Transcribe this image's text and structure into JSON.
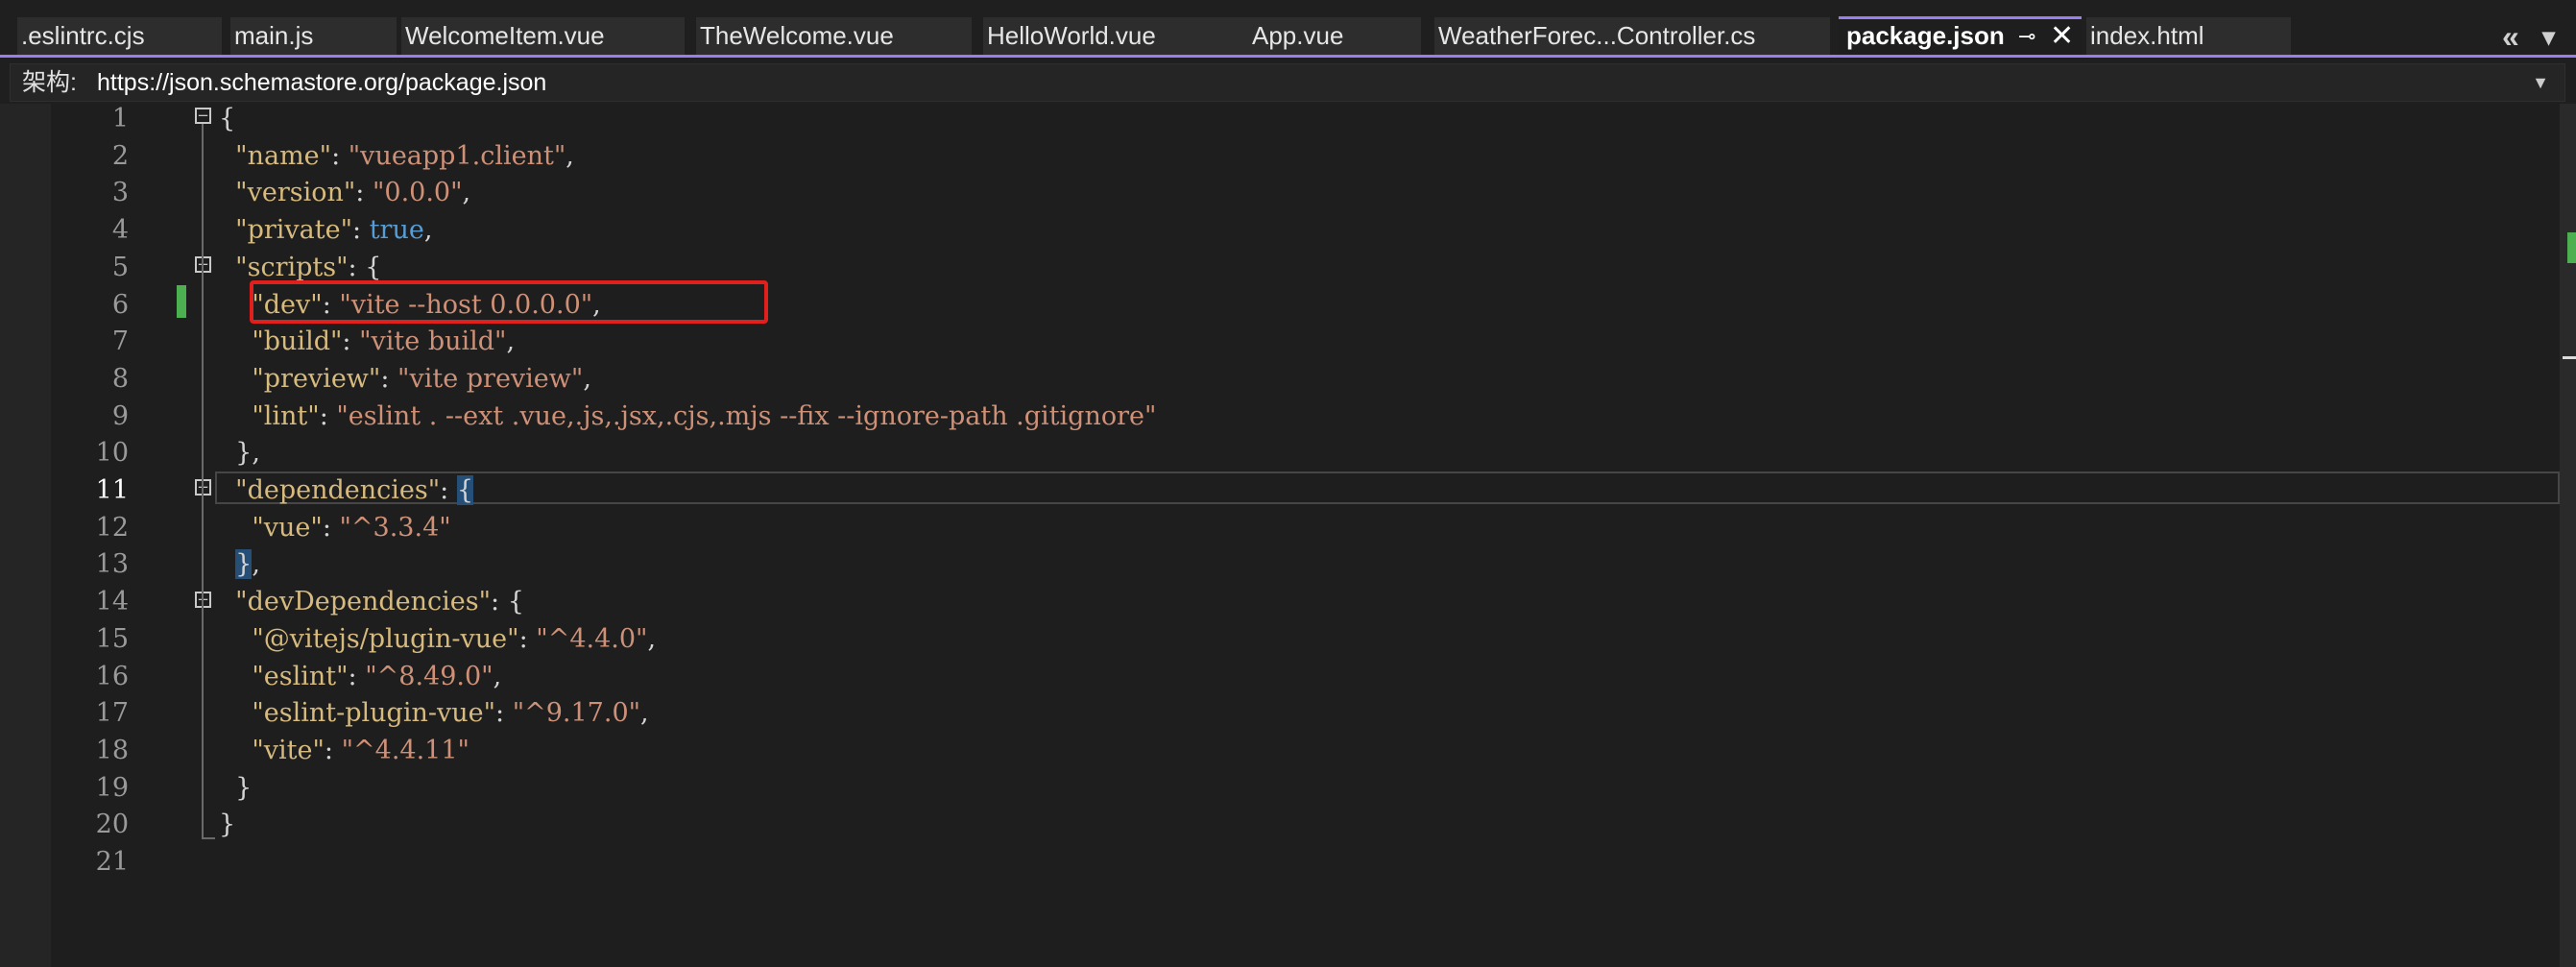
{
  "tabs": [
    {
      "label": ".eslintrc.cjs",
      "active": false
    },
    {
      "label": "main.js",
      "active": false
    },
    {
      "label": "WelcomeItem.vue",
      "active": false
    },
    {
      "label": "TheWelcome.vue",
      "active": false
    },
    {
      "label": "HelloWorld.vue",
      "active": false
    },
    {
      "label": "App.vue",
      "active": false
    },
    {
      "label": "WeatherForec...Controller.cs",
      "active": false
    },
    {
      "label": "package.json",
      "active": true
    },
    {
      "label": "index.html",
      "active": false
    }
  ],
  "tab_controls": {
    "pin_icon": "pin-icon",
    "close_icon": "close-icon",
    "overflow_left": "«",
    "overflow_menu": "▾"
  },
  "schema": {
    "label": "架构:",
    "value": "https://json.schemastore.org/package.json"
  },
  "editor": {
    "current_line": 11,
    "line_numbers": [
      "1",
      "2",
      "3",
      "4",
      "5",
      "6",
      "7",
      "8",
      "9",
      "10",
      "11",
      "12",
      "13",
      "14",
      "15",
      "16",
      "17",
      "18",
      "19",
      "20",
      "21"
    ],
    "lines": [
      [
        {
          "t": "p",
          "v": "{"
        }
      ],
      [
        {
          "t": "p",
          "v": "  "
        },
        {
          "t": "k",
          "v": "\"name\""
        },
        {
          "t": "p",
          "v": ": "
        },
        {
          "t": "s",
          "v": "\"vueapp1.client\""
        },
        {
          "t": "p",
          "v": ","
        }
      ],
      [
        {
          "t": "p",
          "v": "  "
        },
        {
          "t": "k",
          "v": "\"version\""
        },
        {
          "t": "p",
          "v": ": "
        },
        {
          "t": "s",
          "v": "\"0.0.0\""
        },
        {
          "t": "p",
          "v": ","
        }
      ],
      [
        {
          "t": "p",
          "v": "  "
        },
        {
          "t": "k",
          "v": "\"private\""
        },
        {
          "t": "p",
          "v": ": "
        },
        {
          "t": "b",
          "v": "true"
        },
        {
          "t": "p",
          "v": ","
        }
      ],
      [
        {
          "t": "p",
          "v": "  "
        },
        {
          "t": "k",
          "v": "\"scripts\""
        },
        {
          "t": "p",
          "v": ": {"
        }
      ],
      [
        {
          "t": "p",
          "v": "    "
        },
        {
          "t": "k",
          "v": "\"dev\""
        },
        {
          "t": "p",
          "v": ": "
        },
        {
          "t": "s",
          "v": "\"vite --host 0.0.0.0\""
        },
        {
          "t": "p",
          "v": ","
        }
      ],
      [
        {
          "t": "p",
          "v": "    "
        },
        {
          "t": "k",
          "v": "\"build\""
        },
        {
          "t": "p",
          "v": ": "
        },
        {
          "t": "s",
          "v": "\"vite build\""
        },
        {
          "t": "p",
          "v": ","
        }
      ],
      [
        {
          "t": "p",
          "v": "    "
        },
        {
          "t": "k",
          "v": "\"preview\""
        },
        {
          "t": "p",
          "v": ": "
        },
        {
          "t": "s",
          "v": "\"vite preview\""
        },
        {
          "t": "p",
          "v": ","
        }
      ],
      [
        {
          "t": "p",
          "v": "    "
        },
        {
          "t": "k",
          "v": "\"lint\""
        },
        {
          "t": "p",
          "v": ": "
        },
        {
          "t": "s",
          "v": "\"eslint . --ext .vue,.js,.jsx,.cjs,.mjs --fix --ignore-path .gitignore\""
        }
      ],
      [
        {
          "t": "p",
          "v": "  },"
        }
      ],
      [
        {
          "t": "p",
          "v": "  "
        },
        {
          "t": "k",
          "v": "\"dependencies\""
        },
        {
          "t": "p",
          "v": ": "
        },
        {
          "t": "h",
          "v": "{"
        }
      ],
      [
        {
          "t": "p",
          "v": "    "
        },
        {
          "t": "k",
          "v": "\"vue\""
        },
        {
          "t": "p",
          "v": ": "
        },
        {
          "t": "s",
          "v": "\"^3.3.4\""
        }
      ],
      [
        {
          "t": "p",
          "v": "  "
        },
        {
          "t": "h",
          "v": "}"
        },
        {
          "t": "p",
          "v": ","
        }
      ],
      [
        {
          "t": "p",
          "v": "  "
        },
        {
          "t": "k",
          "v": "\"devDependencies\""
        },
        {
          "t": "p",
          "v": ": {"
        }
      ],
      [
        {
          "t": "p",
          "v": "    "
        },
        {
          "t": "k",
          "v": "\"@vitejs/plugin-vue\""
        },
        {
          "t": "p",
          "v": ": "
        },
        {
          "t": "s",
          "v": "\"^4.4.0\""
        },
        {
          "t": "p",
          "v": ","
        }
      ],
      [
        {
          "t": "p",
          "v": "    "
        },
        {
          "t": "k",
          "v": "\"eslint\""
        },
        {
          "t": "p",
          "v": ": "
        },
        {
          "t": "s",
          "v": "\"^8.49.0\""
        },
        {
          "t": "p",
          "v": ","
        }
      ],
      [
        {
          "t": "p",
          "v": "    "
        },
        {
          "t": "k",
          "v": "\"eslint-plugin-vue\""
        },
        {
          "t": "p",
          "v": ": "
        },
        {
          "t": "s",
          "v": "\"^9.17.0\""
        },
        {
          "t": "p",
          "v": ","
        }
      ],
      [
        {
          "t": "p",
          "v": "    "
        },
        {
          "t": "k",
          "v": "\"vite\""
        },
        {
          "t": "p",
          "v": ": "
        },
        {
          "t": "s",
          "v": "\"^4.4.11\""
        }
      ],
      [
        {
          "t": "p",
          "v": "  }"
        }
      ],
      [
        {
          "t": "p",
          "v": "}"
        }
      ],
      []
    ]
  },
  "colors": {
    "key": "#d7ba7d",
    "string": "#ce9178",
    "boolean": "#569cd6",
    "accent": "#9a7ef0",
    "highlight_box": "#e0201d",
    "change_marker": "#4caf50"
  }
}
